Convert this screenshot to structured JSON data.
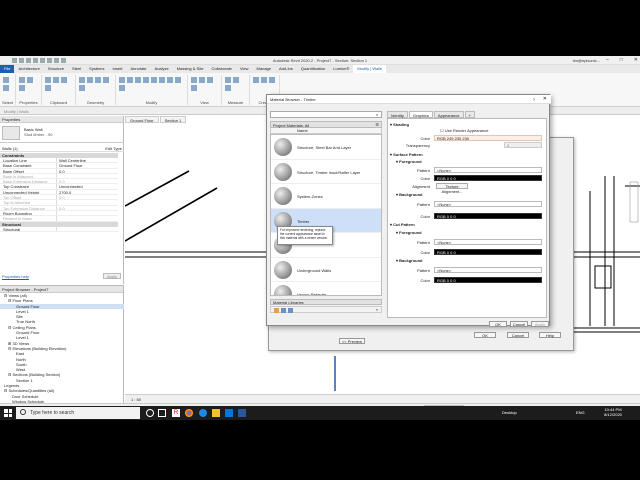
{
  "app": {
    "title": "Autodesk Revit 2020.2 - Project7 - Section: Section 1",
    "user": "tim@episonic...",
    "tabs": [
      "File",
      "Architecture",
      "Structure",
      "Steel",
      "Systems",
      "Insert",
      "Annotate",
      "Analyze",
      "Massing & Site",
      "Collaborate",
      "View",
      "Manage",
      "Add-Ins",
      "Quantification",
      "Lumion®",
      "Modify | Walls"
    ],
    "ribbon_groups": [
      "Select",
      "Properties",
      "Clipboard",
      "Geometry",
      "Modify",
      "View",
      "Measure",
      "Create"
    ],
    "options_bar": "Modify | Walls"
  },
  "properties": {
    "header": "Properties",
    "type_family": "Basic Wall",
    "type_name": "Stud timber - 90",
    "walls_label": "Walls (1)",
    "edit_type": "Edit Type",
    "sections": [
      {
        "title": "Constraints",
        "rows": [
          {
            "k": "Location Line",
            "v": "Wall Centerline",
            "grey": false
          },
          {
            "k": "Base Constraint",
            "v": "Ground Floor",
            "grey": false
          },
          {
            "k": "Base Offset",
            "v": "0.0",
            "grey": false
          },
          {
            "k": "Base is Attached",
            "v": "",
            "grey": true
          },
          {
            "k": "Base Extension Distance",
            "v": "0.0",
            "grey": true
          },
          {
            "k": "Top Constraint",
            "v": "Unconnected",
            "grey": false
          },
          {
            "k": "Unconnected Height",
            "v": "2700.0",
            "grey": false
          },
          {
            "k": "Top Offset",
            "v": "0.0",
            "grey": true
          },
          {
            "k": "Top is Attached",
            "v": "",
            "grey": true
          },
          {
            "k": "Top Extension Distance",
            "v": "0.0",
            "grey": true
          },
          {
            "k": "Room Bounding",
            "v": "",
            "grey": false
          },
          {
            "k": "Related to Mass",
            "v": "",
            "grey": true
          }
        ]
      },
      {
        "title": "Structural",
        "rows": [
          {
            "k": "Structural",
            "v": "",
            "grey": false
          }
        ]
      }
    ],
    "help_link": "Properties help",
    "apply": "Apply"
  },
  "project_browser": {
    "header": "Project Browser - Project7",
    "nodes": [
      {
        "label": "⊟ Views (all)",
        "indent": 1,
        "sel": false
      },
      {
        "label": "⊟ Floor Plans",
        "indent": 2,
        "sel": false
      },
      {
        "label": "Ground Floor",
        "indent": 4,
        "sel": true
      },
      {
        "label": "Level 1",
        "indent": 4,
        "sel": false
      },
      {
        "label": "Site",
        "indent": 4,
        "sel": false
      },
      {
        "label": "True North",
        "indent": 4,
        "sel": false
      },
      {
        "label": "⊟ Ceiling Plans",
        "indent": 2,
        "sel": false
      },
      {
        "label": "Ground Floor",
        "indent": 4,
        "sel": false
      },
      {
        "label": "Level 1",
        "indent": 4,
        "sel": false
      },
      {
        "label": "⊞ 3D Views",
        "indent": 2,
        "sel": false
      },
      {
        "label": "⊟ Elevations (Building Elevation)",
        "indent": 2,
        "sel": false
      },
      {
        "label": "East",
        "indent": 4,
        "sel": false
      },
      {
        "label": "North",
        "indent": 4,
        "sel": false
      },
      {
        "label": "South",
        "indent": 4,
        "sel": false
      },
      {
        "label": "West",
        "indent": 4,
        "sel": false
      },
      {
        "label": "⊟ Sections (Building Section)",
        "indent": 2,
        "sel": false
      },
      {
        "label": "Section 1",
        "indent": 4,
        "sel": false
      },
      {
        "label": "Legends",
        "indent": 1,
        "sel": false
      },
      {
        "label": "⊟ Schedules/Quantities (all)",
        "indent": 1,
        "sel": false
      },
      {
        "label": "Door Schedule",
        "indent": 3,
        "sel": false
      },
      {
        "label": "Window Schedule",
        "indent": 3,
        "sel": false
      },
      {
        "label": "⊞ Sheets (all)",
        "indent": 1,
        "sel": false
      }
    ]
  },
  "view_tabs": [
    "Ground Floor",
    "Section 1"
  ],
  "view_control": "1 : 50",
  "status": {
    "ready": "Ready",
    "main_model": "Main Model"
  },
  "material_browser": {
    "title": "Material Browser - Timber",
    "search_placeholder": "",
    "project_materials": "Project Materials: All",
    "name_col": "Name",
    "materials": [
      {
        "name": "Structure, Steel Bar And Layer",
        "sel": false
      },
      {
        "name": "Structure, Timber Insul/Rafter Layer",
        "sel": false
      },
      {
        "name": "System-Zones",
        "sel": false
      },
      {
        "name": "Timber",
        "sel": true
      },
      {
        "name": "",
        "sel": false
      },
      {
        "name": "Underground Walls",
        "sel": false
      },
      {
        "name": "Vapour Retarder",
        "sel": false
      }
    ],
    "tooltip": "For improved rendering, replace the current appearance asset in this material with a newer version.",
    "material_libraries": "Material Libraries",
    "tabs": [
      "Identity",
      "Graphics",
      "Appearance",
      "+"
    ],
    "shading": {
      "title": "Shading",
      "use_render": "Use Render Appearance",
      "color_label": "Color",
      "color_value": "RGB 249 230 230",
      "transparency_label": "Transparency",
      "transparency_value": "0"
    },
    "surface_pattern": {
      "title": "Surface Pattern",
      "foreground": "Foreground",
      "pattern_label": "Pattern",
      "pattern_value": "<None>",
      "color_label": "Color",
      "color_value": "RGB 0 0 0",
      "alignment_label": "Alignment",
      "alignment_button": "Texture Alignment...",
      "background": "Background",
      "bg_pattern_value": "<None>",
      "bg_color_value": "RGB 0 0 0"
    },
    "cut_pattern": {
      "title": "Cut Pattern",
      "foreground": "Foreground",
      "pattern_value": "<None>",
      "color_value": "RGB 0 0 0",
      "background": "Background",
      "bg_pattern_value": "<None>",
      "bg_color_value": "RGB 0 0 0"
    },
    "buttons": {
      "ok": "OK",
      "cancel": "Cancel",
      "apply": "Apply"
    }
  },
  "back_dialog": {
    "preview": "<< Preview",
    "ok": "OK",
    "cancel": "Cancel",
    "help": "Help"
  },
  "taskbar": {
    "search_placeholder": "Type here to search",
    "desktop": "Desktop",
    "lang": "ENG",
    "time": "10:44 PM",
    "date": "8/12/2020"
  },
  "colors": {
    "file_tab": "#1f5ea8",
    "selection": "#cde0f7",
    "shading_color": "#fdeee6"
  }
}
